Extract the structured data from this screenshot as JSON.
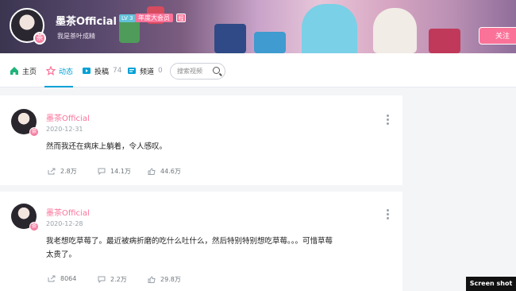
{
  "profile": {
    "username": "墨茶Official",
    "level": "LV 3",
    "vip_label": "年度大会员",
    "vip_mark": "程",
    "signature": "我是茶叶成精",
    "follow_label": "关注",
    "avatar_pendant": "茶"
  },
  "nav": {
    "home": "主页",
    "dynamic": "动态",
    "posts": "投稿",
    "posts_count": "74",
    "channels": "频道",
    "channels_count": "0",
    "search_placeholder": "搜索视频"
  },
  "feed": [
    {
      "name": "墨茶Official",
      "date": "2020-12-31",
      "text": "然而我还在病床上躺着，令人感叹。",
      "share": "2.8万",
      "comment": "14.1万",
      "like": "44.6万",
      "badge": "茶"
    },
    {
      "name": "墨茶Official",
      "date": "2020-12-28",
      "text": "我老想吃草莓了。最近被病折磨的吃什么吐什么，然后特别特别想吃草莓。。。可惜草莓太贵了。",
      "share": "8064",
      "comment": "2.2万",
      "like": "29.8万",
      "badge": "茶"
    }
  ],
  "watermark": "Screen shot",
  "colors": {
    "accent_blue": "#00a1d6",
    "accent_pink": "#fb7299"
  }
}
